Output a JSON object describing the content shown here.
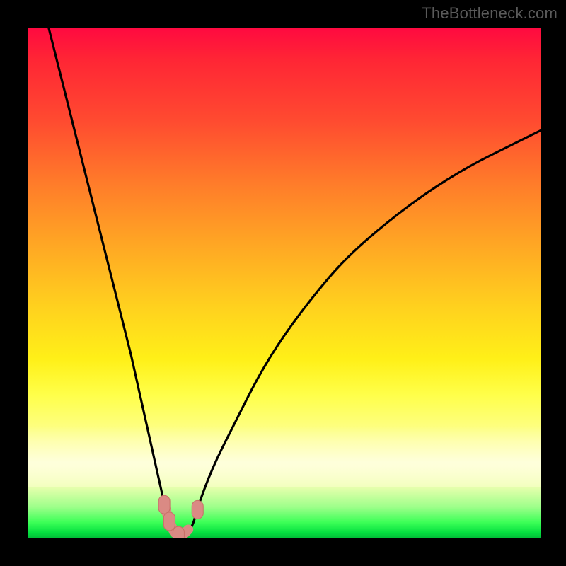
{
  "watermark": {
    "text": "TheBottleneck.com"
  },
  "colors": {
    "curve_stroke": "#000000",
    "marker_fill": "#da8a84",
    "marker_stroke": "#c86f67",
    "background_black": "#000000"
  },
  "chart_data": {
    "type": "line",
    "title": "",
    "subtitle": "",
    "xlabel": "",
    "ylabel": "",
    "xlim": [
      0,
      100
    ],
    "ylim": [
      0,
      100
    ],
    "grid": false,
    "legend": false,
    "annotations": [],
    "series": [
      {
        "name": "bottleneck-curve",
        "description": "V-shaped bottleneck percentage curve; minimum ≈0 near x≈29, steep on left, gentler curved rise on right toward ≈80 at x=100.",
        "x": [
          4,
          8,
          12,
          16,
          20,
          24,
          26,
          27,
          28,
          29,
          30,
          32,
          33,
          36,
          40,
          45,
          50,
          56,
          62,
          70,
          78,
          86,
          94,
          100
        ],
        "values": [
          100,
          84,
          68,
          52,
          36,
          18,
          9,
          4,
          1,
          0,
          0,
          2,
          6,
          14,
          22,
          32,
          40,
          48,
          55,
          62,
          68,
          73,
          77,
          80
        ]
      }
    ],
    "markers": [
      {
        "name": "left-marker-lower",
        "x": 26.5,
        "y": 6.5
      },
      {
        "name": "left-marker-upper",
        "x": 27.5,
        "y": 3.2
      },
      {
        "name": "valley-marker",
        "x": 29.3,
        "y": 0.4
      },
      {
        "name": "right-marker",
        "x": 33.0,
        "y": 5.5
      }
    ],
    "connector": {
      "name": "valley-connector",
      "points_x": [
        26.5,
        27.5,
        28.5,
        29.3,
        30.2,
        31.2
      ],
      "points_y": [
        6.5,
        3.2,
        1.0,
        0.4,
        0.6,
        1.6
      ]
    }
  }
}
